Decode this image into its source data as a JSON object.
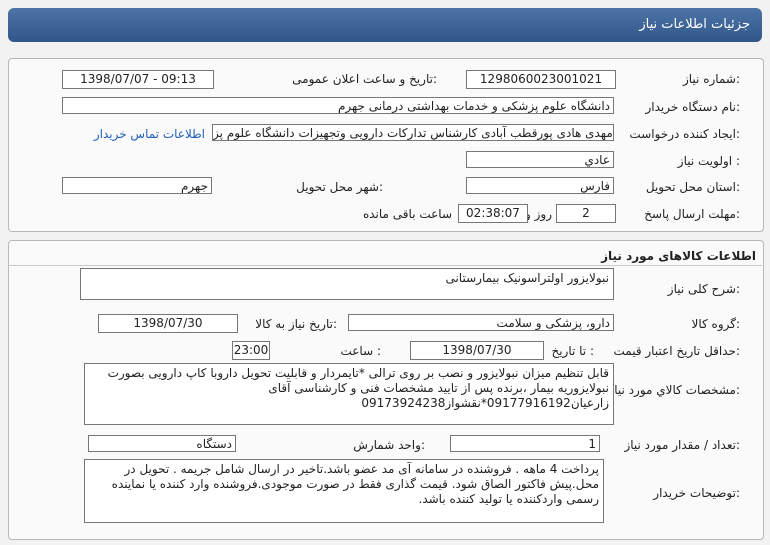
{
  "header": {
    "title": "جزئیات اطلاعات نیاز"
  },
  "info": {
    "need_number_label": "شماره نیاز:",
    "need_number": "1298060023001021",
    "announce_label": "تاریخ و ساعت اعلان عمومی:",
    "announce_value": "1398/07/07 - 09:13",
    "buyer_label": "نام دستگاه خریدار:",
    "buyer_value": "دانشگاه علوم پزشکی و خدمات بهداشتی درمانی جهرم",
    "creator_label": "ایجاد کننده درخواست:",
    "creator_value": "مهدی هادی پورقطب آبادی کارشناس تدارکات دارویی وتجهیزات دانشگاه علوم پز",
    "contact_link": "اطلاعات تماس خریدار",
    "priority_label": "اولویت نیاز :",
    "priority_value": "عادي",
    "province_label": "استان محل تحویل:",
    "province_value": "فارس",
    "city_label": "شهر محل تحویل:",
    "city_value": "جهرم",
    "deadline_label": "مهلت ارسال پاسخ:",
    "days_value": "2",
    "days_word": "روز و",
    "time_value": "02:38:07",
    "remaining_text": "ساعت باقی مانده"
  },
  "goods": {
    "section_title": "اطلاعات کالاهای مورد نیاز",
    "general_desc_label": "شرح کلی نیاز:",
    "general_desc_value": "نبولایزور اولتراسونیک بیمارستانی",
    "group_label": "گروه کالا:",
    "group_value": "دارو، پزشکی و سلامت",
    "need_date_label": "تاریخ نیاز به کالا:",
    "need_date_value": "1398/07/30",
    "validity_label": "حداقل تاریخ اعتبار قیمت:",
    "until_label": "تا تاریخ :",
    "validity_date": "1398/07/30",
    "hour_label": "ساعت :",
    "validity_time": "23:00",
    "spec_label": "مشخصات کالاي مورد نیاز:",
    "spec_value": "قابل تنظیم میزان نبولایزور و نصب بر روی ترالی *تایمردار و قابلیت تحویل داروبا کاپ دارویی بصورت نبولایزوریه بیمار ،برنده پس از تایید مشخصات فنی و کارشناسی آقای زارعیان09177916192*نقشواز09173924238",
    "qty_label": "تعداد / مقدار مورد نیاز:",
    "qty_value": "1",
    "unit_label": "واحد شمارش:",
    "unit_value": "دستگاه",
    "notes_label": "توضیحات خریدار:",
    "notes_value": "پرداخت 4 ماهه . فروشنده در سامانه آی مد عضو باشد.تاخیر در ارسال شامل جریمه  . تحویل در محل.پیش فاکتور الصاق شود. قیمت گذاری فقط در صورت موجودی.فروشنده وارد کننده یا نماینده رسمی واردکننده یا تولید کننده  باشد."
  },
  "colors": {
    "header_top": "#4d74a6",
    "header_bottom": "#31578a",
    "link": "#1f5fb8"
  }
}
